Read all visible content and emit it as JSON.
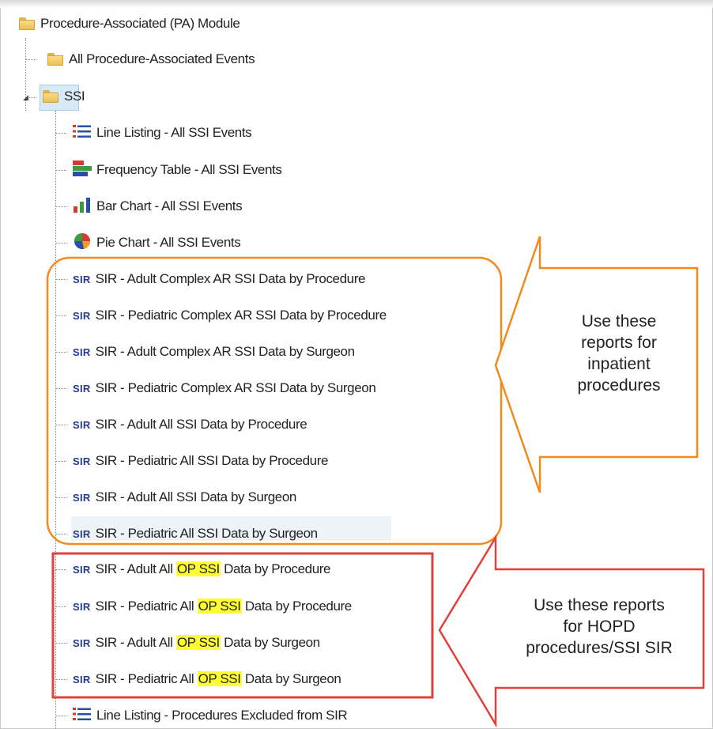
{
  "tree": {
    "root": {
      "label": "Procedure-Associated (PA) Module",
      "icon": "folder-icon"
    },
    "all_events": {
      "label": "All Procedure-Associated Events",
      "icon": "folder-icon"
    },
    "ssi": {
      "label": "SSI",
      "icon": "folder-icon"
    },
    "reports": [
      {
        "label": "Line Listing - All SSI Events",
        "icon": "line-listing-icon"
      },
      {
        "label": "Frequency Table - All SSI Events",
        "icon": "frequency-table-icon"
      },
      {
        "label": "Bar Chart - All SSI Events",
        "icon": "bar-chart-icon"
      },
      {
        "label": "Pie Chart - All SSI Events",
        "icon": "pie-chart-icon"
      }
    ],
    "sir_badge": "SIR",
    "sir_inpatient": [
      "SIR - Adult Complex AR SSI Data by Procedure",
      "SIR - Pediatric Complex AR SSI Data by Procedure",
      "SIR - Adult Complex AR SSI Data by Surgeon",
      "SIR - Pediatric Complex AR SSI Data by Surgeon",
      "SIR - Adult All SSI Data by Procedure",
      "SIR - Pediatric All SSI Data by Procedure",
      "SIR - Adult All SSI Data by Surgeon",
      "SIR - Pediatric All SSI Data by Surgeon"
    ],
    "sir_op": [
      {
        "pre": "SIR - Adult All ",
        "hl": "OP SSI",
        "post": " Data by Procedure"
      },
      {
        "pre": "SIR - Pediatric All ",
        "hl": "OP SSI",
        "post": " Data by Procedure"
      },
      {
        "pre": "SIR - Adult All ",
        "hl": "OP SSI",
        "post": " Data by Surgeon"
      },
      {
        "pre": "SIR - Pediatric All ",
        "hl": "OP SSI",
        "post": " Data by Surgeon"
      }
    ],
    "excluded": {
      "label": "Line Listing - Procedures Excluded from SIR",
      "icon": "line-listing-icon"
    }
  },
  "callouts": {
    "inpatient": {
      "lines": [
        "Use these",
        "reports for",
        "inpatient",
        "procedures"
      ],
      "color": "#f28a1e"
    },
    "hopd": {
      "lines": [
        "Use these reports",
        "for HOPD",
        "procedures/SSI SIR"
      ],
      "color": "#e0413a"
    }
  },
  "colors": {
    "selection": "#d8eaf7",
    "highlight": "#ffff33",
    "sir_badge": "#243a8c"
  }
}
